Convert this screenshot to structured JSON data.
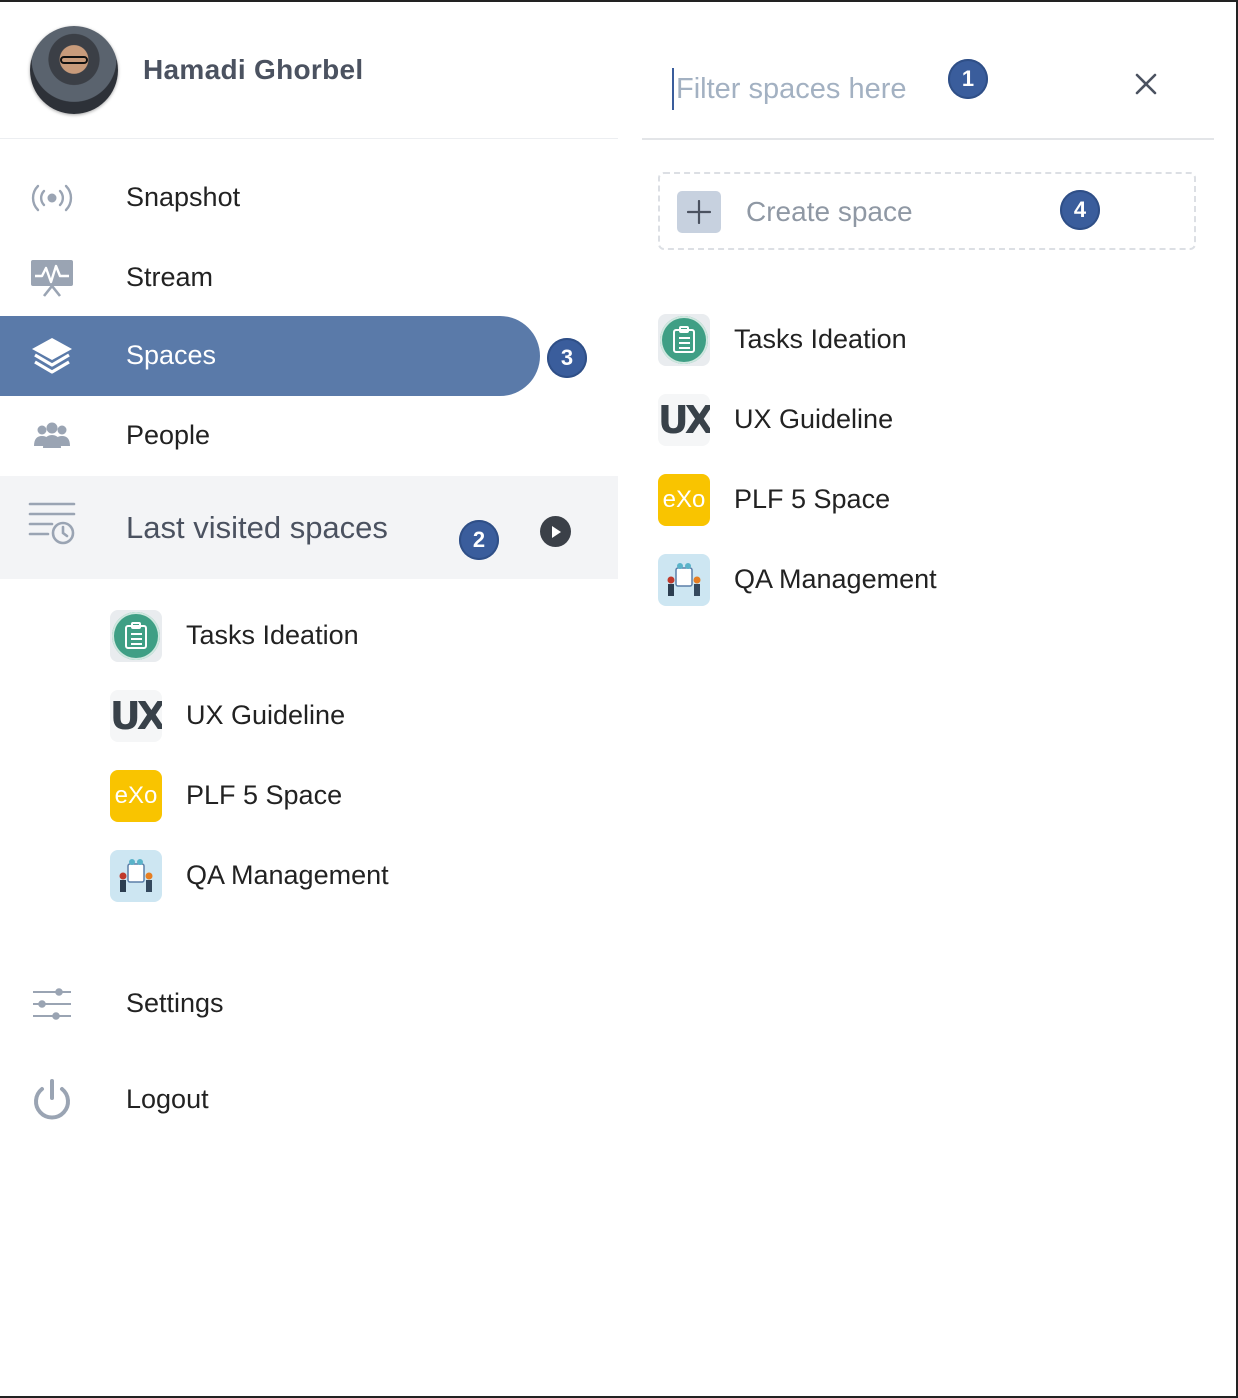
{
  "profile": {
    "name": "Hamadi Ghorbel"
  },
  "nav": {
    "items": [
      {
        "label": "Snapshot",
        "icon": "broadcast-icon"
      },
      {
        "label": "Stream",
        "icon": "activity-stream-icon"
      },
      {
        "label": "Spaces",
        "icon": "layers-icon",
        "active": true
      },
      {
        "label": "People",
        "icon": "people-icon"
      }
    ],
    "recent": {
      "label": "Last visited spaces",
      "icon": "recent-spaces-icon"
    },
    "settings": {
      "label": "Settings",
      "icon": "sliders-icon"
    },
    "logout": {
      "label": "Logout",
      "icon": "power-icon"
    }
  },
  "badges": {
    "filter": "1",
    "recent": "2",
    "spaces": "3",
    "create": "4"
  },
  "recent_spaces": [
    {
      "name": "Tasks Ideation",
      "thumb": "tasks"
    },
    {
      "name": "UX Guideline",
      "thumb": "ux"
    },
    {
      "name": "PLF 5 Space",
      "thumb": "plf"
    },
    {
      "name": "QA Management",
      "thumb": "qa"
    }
  ],
  "spaces_panel": {
    "filter_placeholder": "Filter spaces here",
    "create_label": "Create space",
    "spaces": [
      {
        "name": "Tasks Ideation",
        "thumb": "tasks"
      },
      {
        "name": "UX Guideline",
        "thumb": "ux"
      },
      {
        "name": "PLF 5 Space",
        "thumb": "plf"
      },
      {
        "name": "QA Management",
        "thumb": "qa"
      }
    ]
  },
  "thumb_text": {
    "ux": "UX",
    "plf": "eXo"
  },
  "colors": {
    "accent": "#5a7aa9",
    "badge": "#3a5d9c",
    "exo_yellow": "#f9c400",
    "tasks_green": "#3f9f85"
  }
}
